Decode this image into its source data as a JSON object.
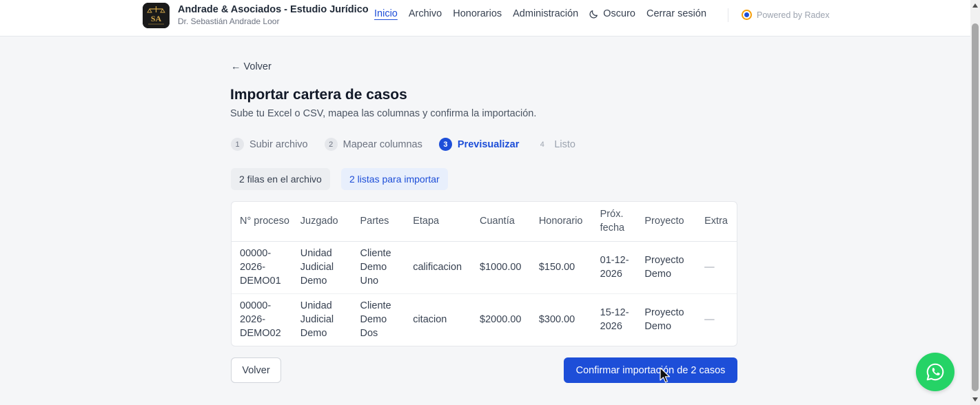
{
  "header": {
    "brand_title": "Andrade & Asociados - Estudio Jurídico",
    "brand_subtitle": "Dr. Sebastián Andrade Loor",
    "nav": [
      "Inicio",
      "Archivo",
      "Honorarios",
      "Administración"
    ],
    "dark_label": "Oscuro",
    "logout_label": "Cerrar sesión",
    "powered_by": "Powered by Radex",
    "logo_letters": "SA"
  },
  "main": {
    "back_link": "← Volver",
    "title": "Importar cartera de casos",
    "subtitle": "Sube tu Excel o CSV, mapea las columnas y confirma la importación.",
    "steps": [
      {
        "num": "1",
        "label": "Subir archivo"
      },
      {
        "num": "2",
        "label": "Mapear columnas"
      },
      {
        "num": "3",
        "label": "Previsualizar"
      },
      {
        "num": "4",
        "label": "Listo"
      }
    ],
    "rows_in_file": "2 filas en el archivo",
    "rows_ready": "2 listas para importar",
    "table": {
      "headers": [
        "N° proceso",
        "Juzgado",
        "Partes",
        "Etapa",
        "Cuantía",
        "Honorario",
        "Próx. fecha",
        "Proyecto",
        "Extra"
      ],
      "rows": [
        [
          "00000-2026-DEMO01",
          "Unidad Judicial Demo",
          "Cliente Demo Uno",
          "calificacion",
          "$1000.00",
          "$150.00",
          "01-12-2026",
          "Proyecto Demo",
          "—"
        ],
        [
          "00000-2026-DEMO02",
          "Unidad Judicial Demo",
          "Cliente Demo Dos",
          "citacion",
          "$2000.00",
          "$300.00",
          "15-12-2026",
          "Proyecto Demo",
          "—"
        ]
      ]
    },
    "back_button": "Volver",
    "confirm_button": "Confirmar importación de 2 casos"
  },
  "colors": {
    "accent": "#1d4ed8",
    "whatsapp": "#25d366"
  }
}
